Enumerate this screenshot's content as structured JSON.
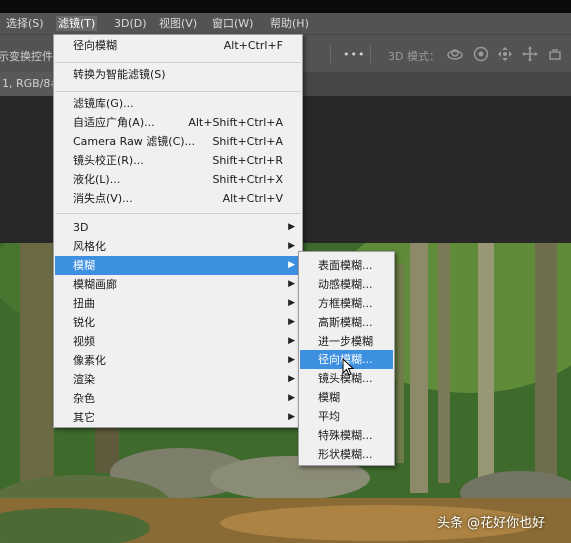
{
  "menubar": {
    "items": [
      {
        "label": "选择(S)"
      },
      {
        "label": "滤镜(T)"
      },
      {
        "label": "3D(D)"
      },
      {
        "label": "视图(V)"
      },
      {
        "label": "窗口(W)"
      },
      {
        "label": "帮助(H)"
      }
    ]
  },
  "options_bar": {
    "transform_controls_label": "示变换控件",
    "mode_3d_label": "3D 模式：",
    "more_label": "•••"
  },
  "document_tab": {
    "label": "1, RGB/8#"
  },
  "filter_menu": {
    "items": [
      {
        "label": "径向模糊",
        "shortcut": "Alt+Ctrl+F"
      },
      {
        "label": "转换为智能滤镜(S)",
        "shortcut": ""
      },
      {
        "label": "滤镜库(G)...",
        "shortcut": ""
      },
      {
        "label": "自适应广角(A)...",
        "shortcut": "Alt+Shift+Ctrl+A"
      },
      {
        "label": "Camera Raw 滤镜(C)...",
        "shortcut": "Shift+Ctrl+A"
      },
      {
        "label": "镜头校正(R)...",
        "shortcut": "Shift+Ctrl+R"
      },
      {
        "label": "液化(L)...",
        "shortcut": "Shift+Ctrl+X"
      },
      {
        "label": "消失点(V)...",
        "shortcut": "Alt+Ctrl+V"
      },
      {
        "label": "3D"
      },
      {
        "label": "风格化"
      },
      {
        "label": "模糊"
      },
      {
        "label": "模糊画廊"
      },
      {
        "label": "扭曲"
      },
      {
        "label": "锐化"
      },
      {
        "label": "视频"
      },
      {
        "label": "像素化"
      },
      {
        "label": "渲染"
      },
      {
        "label": "杂色"
      },
      {
        "label": "其它"
      }
    ]
  },
  "blur_submenu": {
    "items": [
      {
        "label": "表面模糊..."
      },
      {
        "label": "动感模糊..."
      },
      {
        "label": "方框模糊..."
      },
      {
        "label": "高斯模糊..."
      },
      {
        "label": "进一步模糊"
      },
      {
        "label": "径向模糊..."
      },
      {
        "label": "镜头模糊..."
      },
      {
        "label": "模糊"
      },
      {
        "label": "平均"
      },
      {
        "label": "特殊模糊..."
      },
      {
        "label": "形状模糊..."
      }
    ]
  },
  "watermark": {
    "text": "头条 @花好你也好"
  },
  "colors": {
    "highlight": "#3d8fe0",
    "menu_bg": "#f0f0f0",
    "chrome": "#535353"
  }
}
